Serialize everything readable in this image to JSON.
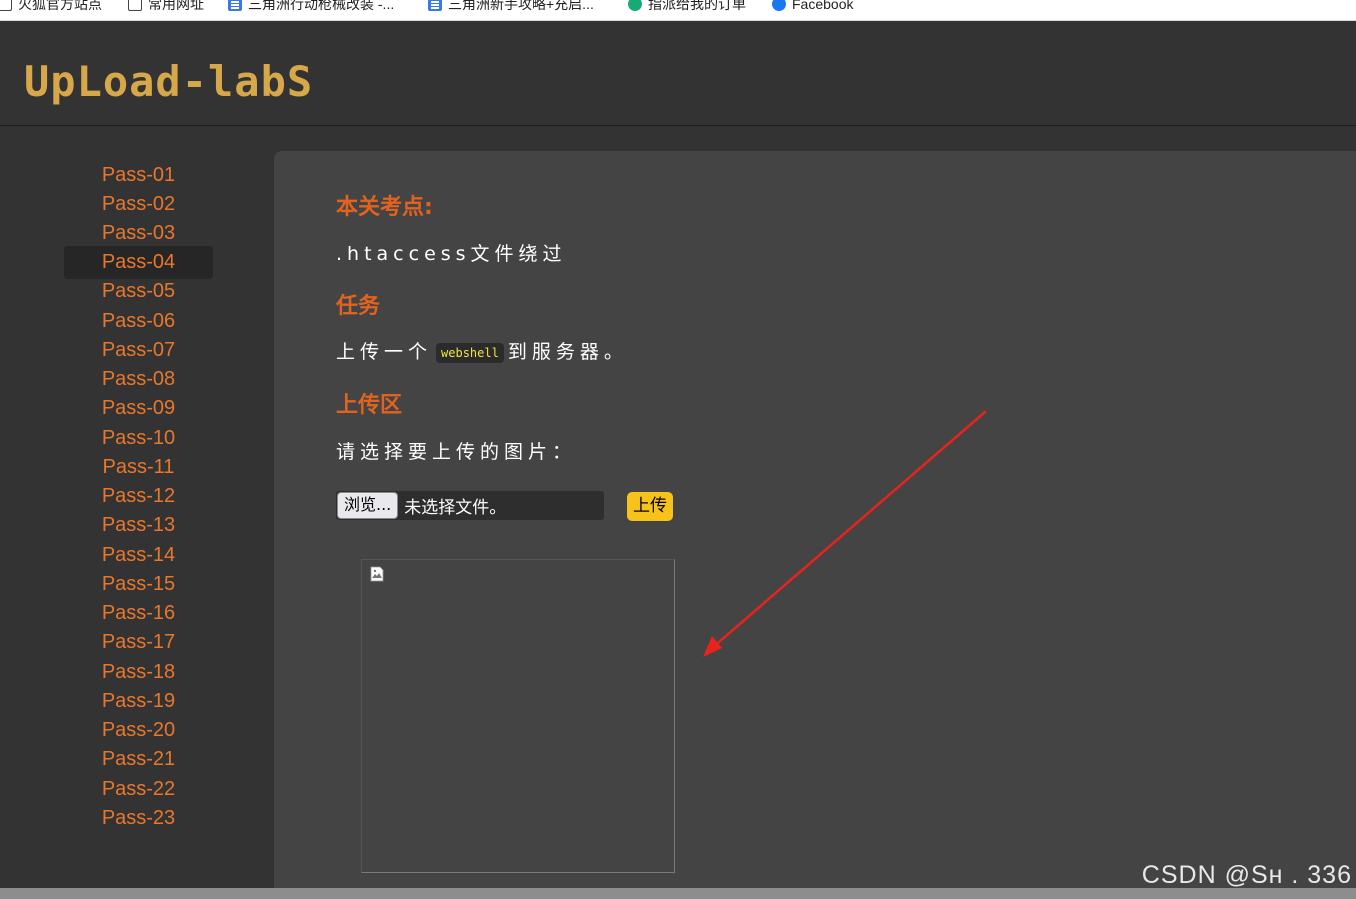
{
  "bookmarks": [
    {
      "label": "火狐官方站点",
      "icon": "checkbox-icon"
    },
    {
      "label": "常用网址",
      "icon": "checkbox-icon"
    },
    {
      "label": "三角洲行动枪械改装 -...",
      "icon": "document-icon"
    },
    {
      "label": "三角洲新手攻略+充启...",
      "icon": "document-icon"
    },
    {
      "label": "指派给我的订单",
      "icon": "green-badge-icon"
    },
    {
      "label": "Facebook",
      "icon": "facebook-icon"
    }
  ],
  "header": {
    "logo_text": "UpLoad-labS"
  },
  "sidebar": {
    "active_index": 3,
    "items": [
      "Pass-01",
      "Pass-02",
      "Pass-03",
      "Pass-04",
      "Pass-05",
      "Pass-06",
      "Pass-07",
      "Pass-08",
      "Pass-09",
      "Pass-10",
      "Pass-11",
      "Pass-12",
      "Pass-13",
      "Pass-14",
      "Pass-15",
      "Pass-16",
      "Pass-17",
      "Pass-18",
      "Pass-19",
      "Pass-20",
      "Pass-21",
      "Pass-22",
      "Pass-23"
    ]
  },
  "content": {
    "section1_title": "本关考点:",
    "section1_text": ".htaccess文件绕过",
    "section2_title": "任务",
    "task_prefix": "上传一个",
    "task_code": "webshell",
    "task_suffix": "到服务器。",
    "section3_title": "上传区",
    "upload_prompt": "请选择要上传的图片：",
    "browse_label": "浏览...",
    "file_status": "未选择文件。",
    "upload_label": "上传"
  },
  "watermark": "CSDN @Sн   . 336",
  "colors": {
    "accent_orange": "#e8772e",
    "title_orange": "#e2631f",
    "logo_gold": "#d6a84a",
    "upload_yellow": "#f7c21b",
    "arrow_red": "#e8231c"
  }
}
